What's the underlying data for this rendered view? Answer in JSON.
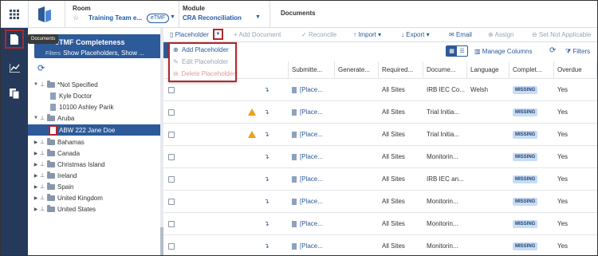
{
  "header": {
    "room_label": "Room",
    "room_value": "Training Team e...",
    "room_badge": "eTMF",
    "module_label": "Module",
    "module_value": "CRA Reconciliation",
    "page_title": "Documents"
  },
  "rail": {
    "tooltip": "Documents"
  },
  "filter": {
    "title": "eTMF Completeness",
    "filters_label": "Filters",
    "filters_value": "Show Placeholders, Show ..."
  },
  "tree": [
    {
      "label": "*Not Specified",
      "kind": "folder"
    },
    {
      "label": "Kyle Doctor",
      "kind": "doc"
    },
    {
      "label": "10100 Ashley Parik",
      "kind": "doc"
    },
    {
      "label": "Aruba",
      "kind": "folder"
    },
    {
      "label": "ABW 222 Jane Doe",
      "kind": "doc"
    },
    {
      "label": "Bahamas",
      "kind": "folder"
    },
    {
      "label": "Canada",
      "kind": "folder"
    },
    {
      "label": "Christmas Island",
      "kind": "folder"
    },
    {
      "label": "Ireland",
      "kind": "folder"
    },
    {
      "label": "Spain",
      "kind": "folder"
    },
    {
      "label": "United Kingdom",
      "kind": "folder"
    },
    {
      "label": "United States",
      "kind": "folder"
    }
  ],
  "toolbar": {
    "placeholder": "Placeholder",
    "add_document": "Add Document",
    "reconcile": "Reconcile",
    "import": "Import",
    "export": "Export",
    "email": "Email",
    "assign": "Assign",
    "set_not_applicable": "Set Not Applicable",
    "manage_columns": "Manage Columns",
    "filters": "Filters"
  },
  "menu": {
    "add": "Add Placeholder",
    "edit": "Edit Placeholder",
    "delete": "Delete Placeholder"
  },
  "table": {
    "columns": [
      "Submitte...",
      "Generate...",
      "Required...",
      "Docume...",
      "Language",
      "Complet...",
      "Overdue"
    ],
    "rows": [
      {
        "warn": false,
        "sub": "[Place...",
        "req": "All Sites",
        "doc": "IRB IEC Co...",
        "lang": "Welsh",
        "status": "MISSING",
        "overdue": "Yes"
      },
      {
        "warn": true,
        "sub": "[Place...",
        "req": "All Sites",
        "doc": "Trial Initia...",
        "lang": "",
        "status": "MISSING",
        "overdue": "Yes"
      },
      {
        "warn": true,
        "sub": "[Place...",
        "req": "All Sites",
        "doc": "Trial Initia...",
        "lang": "",
        "status": "MISSING",
        "overdue": "Yes"
      },
      {
        "warn": false,
        "sub": "[Place...",
        "req": "All Sites",
        "doc": "Monitorin...",
        "lang": "",
        "status": "MISSING",
        "overdue": "Yes"
      },
      {
        "warn": false,
        "sub": "[Place...",
        "req": "All Sites",
        "doc": "IRB IEC an...",
        "lang": "",
        "status": "MISSING",
        "overdue": "Yes"
      },
      {
        "warn": false,
        "sub": "[Place...",
        "req": "All Sites",
        "doc": "Monitorin...",
        "lang": "",
        "status": "MISSING",
        "overdue": "Yes"
      },
      {
        "warn": false,
        "sub": "[Place...",
        "req": "All Sites",
        "doc": "Monitorin...",
        "lang": "",
        "status": "MISSING",
        "overdue": "Yes"
      },
      {
        "warn": false,
        "sub": "[Place...",
        "req": "All Sites",
        "doc": "Monitorin...",
        "lang": "",
        "status": "MISSING",
        "overdue": "Yes"
      }
    ]
  },
  "colors": {
    "navy": "#253a5a",
    "primary": "#2d5a99",
    "highlight": "#b0282b",
    "warning": "#f0a019"
  }
}
